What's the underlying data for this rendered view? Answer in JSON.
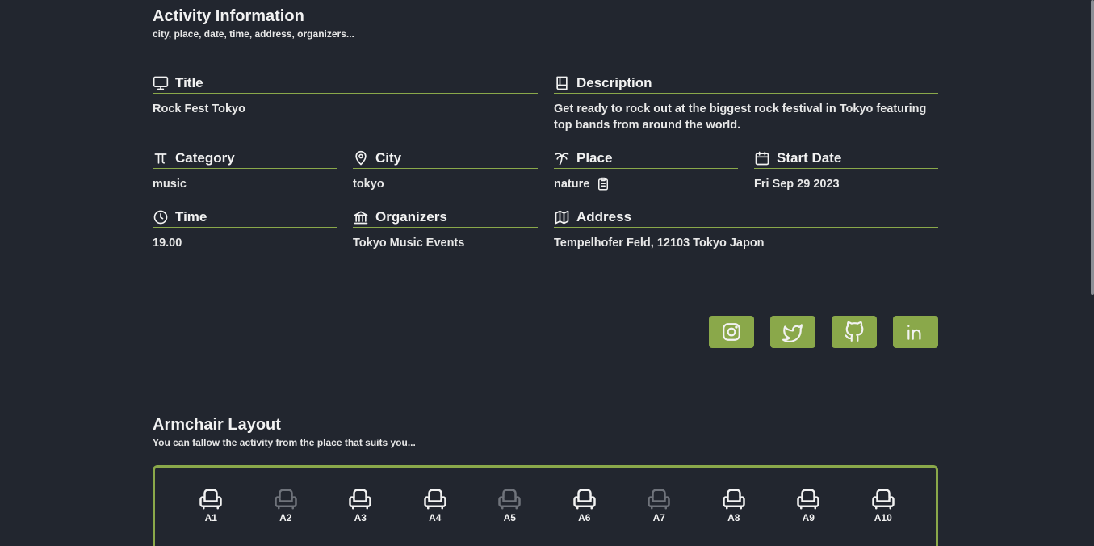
{
  "activity": {
    "title": "Activity Information",
    "subtitle": "city, place, date, time, address, organizers..."
  },
  "fields": {
    "title": {
      "label": "Title",
      "value": "Rock Fest Tokyo",
      "icon": "monitor-icon"
    },
    "description": {
      "label": "Description",
      "value": "Get ready to rock out at the biggest rock festival in Tokyo featuring top bands from around the world.",
      "icon": "book-icon"
    },
    "category": {
      "label": "Category",
      "value": "music",
      "icon": "pi-icon"
    },
    "city": {
      "label": "City",
      "value": "tokyo",
      "icon": "map-pin-icon"
    },
    "place": {
      "label": "Place",
      "value": "nature",
      "icon": "palm-tree-icon"
    },
    "start_date": {
      "label": "Start Date",
      "value": "Fri Sep 29 2023",
      "icon": "calendar-icon"
    },
    "time": {
      "label": "Time",
      "value": "19.00",
      "icon": "clock-icon"
    },
    "organizers": {
      "label": "Organizers",
      "value": "Tokyo Music Events",
      "icon": "bank-icon"
    },
    "address": {
      "label": "Address",
      "value": "Tempelhofer Feld, 12103 Tokyo Japon",
      "icon": "map-icon"
    }
  },
  "social": [
    "instagram-icon",
    "twitter-icon",
    "github-icon",
    "linkedin-icon"
  ],
  "armchair": {
    "title": "Armchair Layout",
    "subtitle": "You can fallow the activity from the place that suits you...",
    "seats": [
      {
        "label": "A1",
        "taken": false
      },
      {
        "label": "A2",
        "taken": true
      },
      {
        "label": "A3",
        "taken": false
      },
      {
        "label": "A4",
        "taken": false
      },
      {
        "label": "A5",
        "taken": true
      },
      {
        "label": "A6",
        "taken": false
      },
      {
        "label": "A7",
        "taken": true
      },
      {
        "label": "A8",
        "taken": false
      },
      {
        "label": "A9",
        "taken": false
      },
      {
        "label": "A10",
        "taken": false
      }
    ]
  },
  "colors": {
    "accent": "#8aa84a",
    "background": "#22262f",
    "taken_seat": "#6f737b"
  }
}
